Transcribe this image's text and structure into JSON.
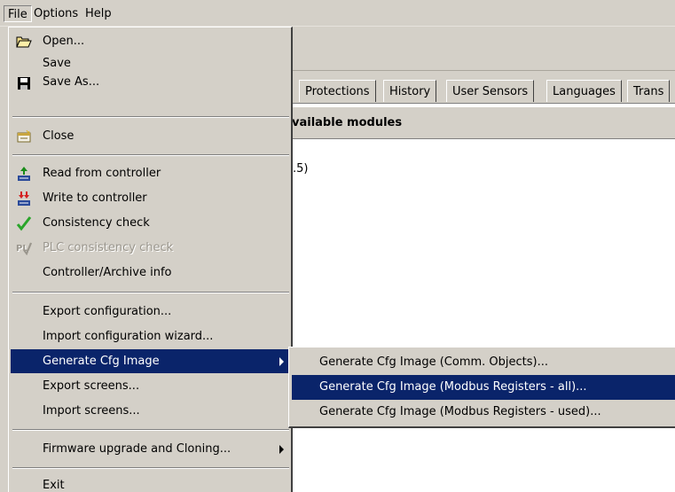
{
  "menubar": {
    "file": "File",
    "options": "Options",
    "help": "Help"
  },
  "tabs": [
    {
      "label": "Protections"
    },
    {
      "label": "History"
    },
    {
      "label": "User Sensors"
    },
    {
      "label": "Languages"
    },
    {
      "label": "Trans"
    }
  ],
  "panel": {
    "header": "vailable modules",
    "row_text": ".5)"
  },
  "file_menu": {
    "open": "Open...",
    "save": "Save",
    "save_as": "Save As...",
    "close": "Close",
    "read_from_controller": "Read from controller",
    "write_to_controller": "Write to controller",
    "consistency_check": "Consistency check",
    "plc_consistency_check": "PLC consistency check",
    "controller_archive_info": "Controller/Archive info",
    "export_configuration": "Export configuration...",
    "import_configuration_wizard": "Import configuration wizard...",
    "generate_cfg_image": "Generate Cfg Image",
    "export_screens": "Export screens...",
    "import_screens": "Import screens...",
    "firmware_upgrade": "Firmware upgrade and Cloning...",
    "exit": "Exit"
  },
  "submenu": {
    "comm_objects": "Generate Cfg Image (Comm. Objects)...",
    "modbus_all": "Generate Cfg Image (Modbus Registers - all)...",
    "modbus_used": "Generate Cfg Image (Modbus Registers - used)..."
  },
  "colors": {
    "menu_bg": "#d4d0c8",
    "highlight": "#0a246a",
    "highlight_text": "#ffffff",
    "disabled_text": "#9a968d"
  },
  "icons": {
    "open": "folder-open-icon",
    "save_as": "floppy-disk-icon",
    "close": "close-document-icon",
    "read": "read-from-controller-icon",
    "write": "write-to-controller-icon",
    "consistency": "checkmark-icon",
    "plc": "plc-check-icon",
    "submenu_arrow": "submenu-arrow-icon"
  }
}
